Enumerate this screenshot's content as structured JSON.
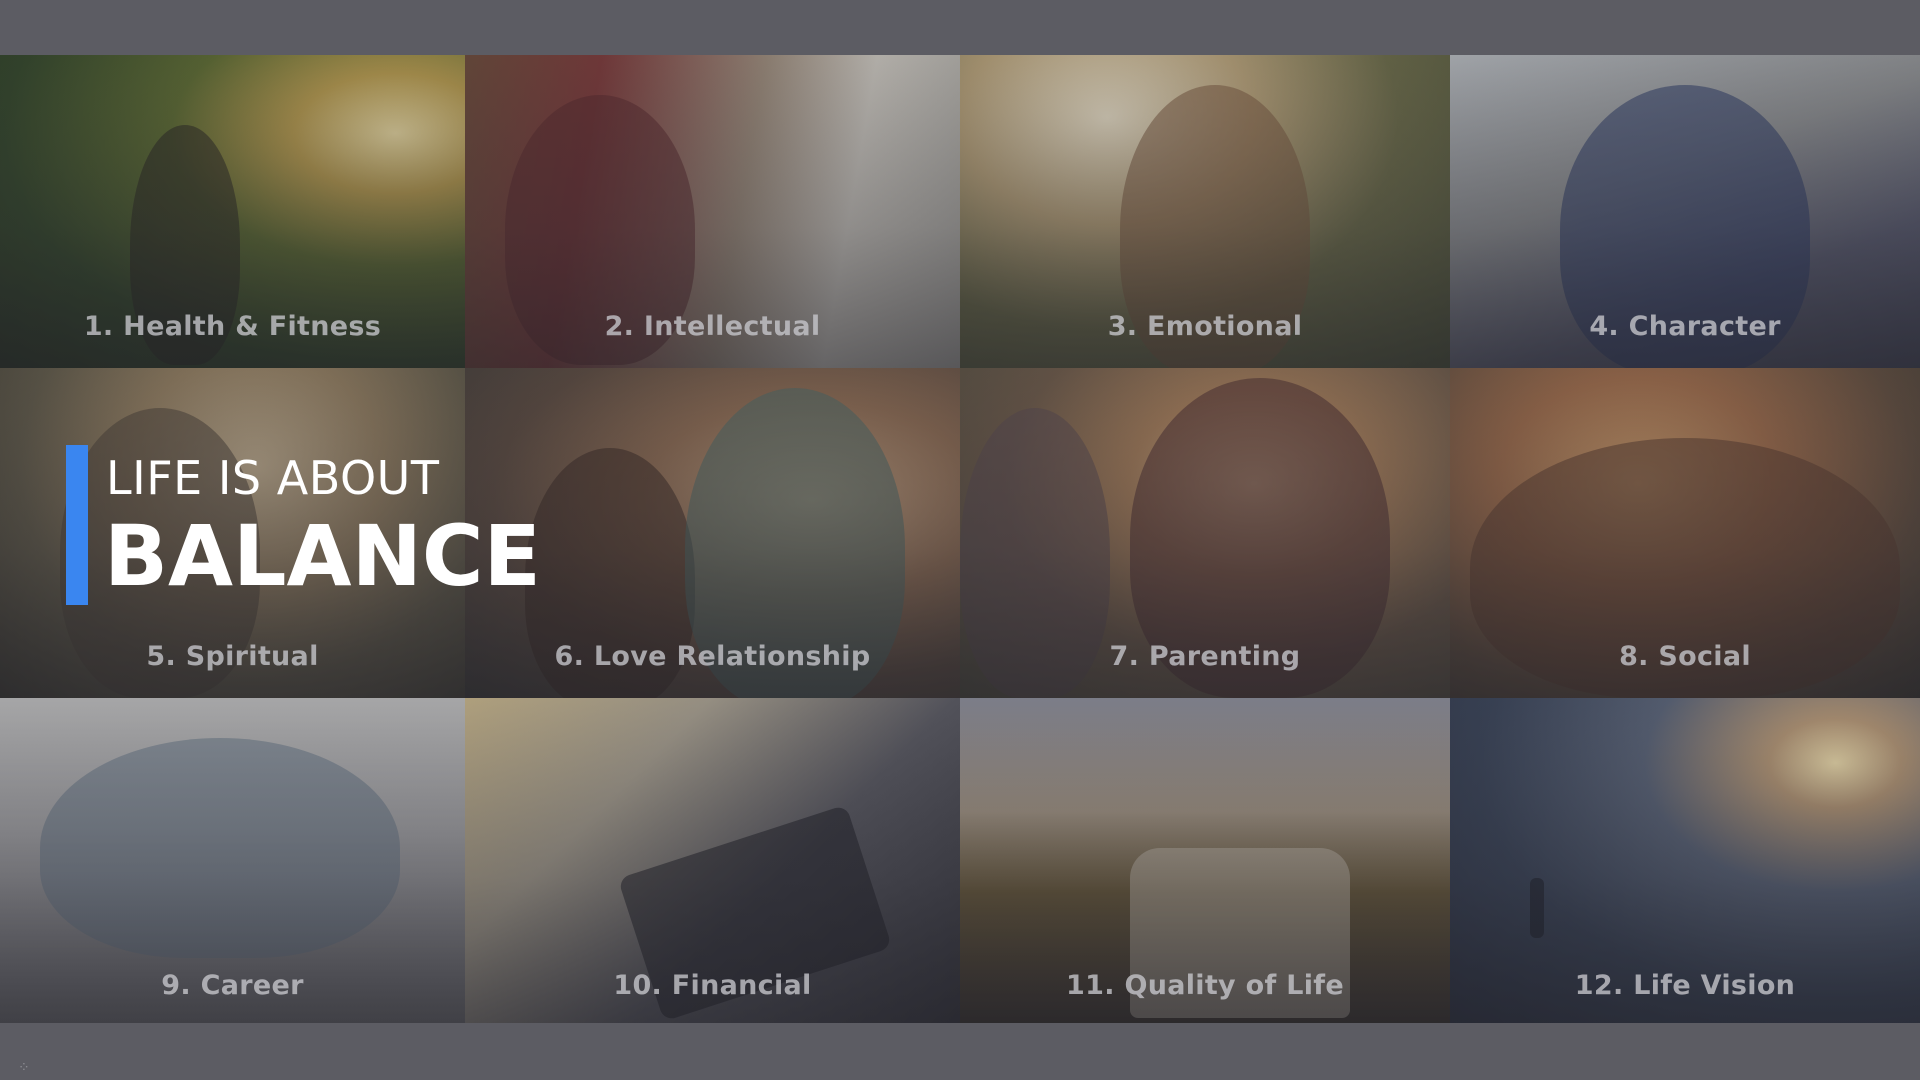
{
  "headline": {
    "line1": "LIFE IS ABOUT",
    "line2": "BALANCE",
    "accent_color": "#3a86f0"
  },
  "tiles": [
    {
      "label": "1. Health & Fitness"
    },
    {
      "label": "2. Intellectual"
    },
    {
      "label": "3. Emotional"
    },
    {
      "label": "4. Character"
    },
    {
      "label": "5. Spiritual"
    },
    {
      "label": "6. Love Relationship"
    },
    {
      "label": "7. Parenting"
    },
    {
      "label": "8. Social"
    },
    {
      "label": "9. Career"
    },
    {
      "label": "10. Financial"
    },
    {
      "label": "11. Quality of Life"
    },
    {
      "label": "12. Life Vision"
    }
  ],
  "colors": {
    "background": "#5c5c63",
    "label_text": "#c8c8cd"
  }
}
